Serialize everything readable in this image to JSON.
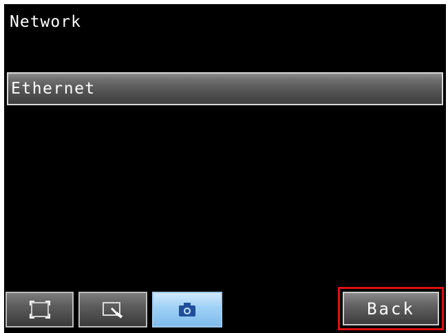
{
  "screen": {
    "title": "Network"
  },
  "menu": {
    "items": [
      {
        "label": "Ethernet"
      }
    ]
  },
  "toolbar": {
    "buttons": [
      {
        "icon": "frame-icon",
        "active": false
      },
      {
        "icon": "zoom-icon",
        "active": false
      },
      {
        "icon": "camera-icon",
        "active": true
      }
    ],
    "back_label": "Back"
  },
  "colors": {
    "background": "#000000",
    "text": "#ffffff",
    "active_button": "#9ed0f6",
    "camera_icon": "#1f4e9c",
    "highlight_outline": "#e01010"
  }
}
